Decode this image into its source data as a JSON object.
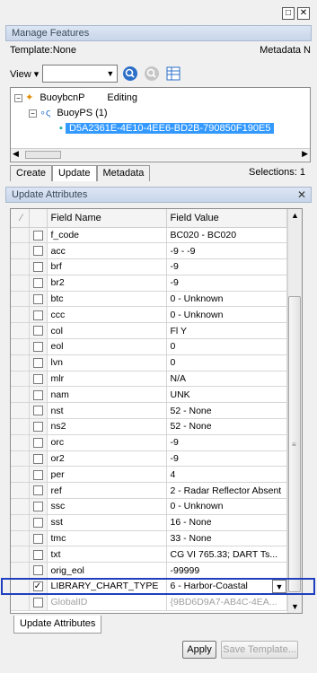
{
  "titlebar": {
    "restore_glyph": "□",
    "close_glyph": "✕"
  },
  "manage_features": {
    "title": "Manage Features",
    "template_label": "Template:None",
    "template_right": "Metadata N",
    "view_label": "View ▾",
    "tree": {
      "layer": "BuoybcnP",
      "layer_status": "Editing",
      "class": "BuoyPS (1)",
      "feature": "D5A2361E-4E10-4EE6-BD2B-790850F190E5"
    },
    "tabs": [
      "Create",
      "Update",
      "Metadata"
    ],
    "selections": "Selections: 1"
  },
  "update_attributes": {
    "title": "Update Attributes",
    "columns": {
      "check": "",
      "name": "Field Name",
      "value": "Field Value"
    },
    "rows": [
      {
        "name": "f_code",
        "value": "BC020 - BC020",
        "checked": false
      },
      {
        "name": "acc",
        "value": "-9 - -9",
        "checked": false
      },
      {
        "name": "brf",
        "value": "-9",
        "checked": false
      },
      {
        "name": "br2",
        "value": "-9",
        "checked": false
      },
      {
        "name": "btc",
        "value": "0 - Unknown",
        "checked": false
      },
      {
        "name": "ccc",
        "value": "0 - Unknown",
        "checked": false
      },
      {
        "name": "col",
        "value": "Fl Y",
        "checked": false
      },
      {
        "name": "eol",
        "value": "0",
        "checked": false
      },
      {
        "name": "lvn",
        "value": "0",
        "checked": false
      },
      {
        "name": "mlr",
        "value": "N/A",
        "checked": false
      },
      {
        "name": "nam",
        "value": "UNK",
        "checked": false
      },
      {
        "name": "nst",
        "value": "52 - None",
        "checked": false
      },
      {
        "name": "ns2",
        "value": "52 - None",
        "checked": false
      },
      {
        "name": "orc",
        "value": "-9",
        "checked": false
      },
      {
        "name": "or2",
        "value": "-9",
        "checked": false
      },
      {
        "name": "per",
        "value": "4",
        "checked": false
      },
      {
        "name": "ref",
        "value": "2 - Radar Reflector Absent",
        "checked": false
      },
      {
        "name": "ssc",
        "value": "0 - Unknown",
        "checked": false
      },
      {
        "name": "sst",
        "value": "16 - None",
        "checked": false
      },
      {
        "name": "tmc",
        "value": "33 - None",
        "checked": false
      },
      {
        "name": "txt",
        "value": "CG VI 765.33; DART Ts...",
        "checked": false
      },
      {
        "name": "orig_eol",
        "value": "-99999",
        "checked": false
      },
      {
        "name": "LIBRARY_CHART_TYPE",
        "value": "6 - Harbor-Coastal",
        "checked": true
      },
      {
        "name": "GlobalID",
        "value": "{9BD6D9A7-AB4C-4EA...",
        "checked": false
      }
    ],
    "bottom_tab": "Update Attributes",
    "apply_label": "Apply",
    "save_template_label": "Save Template..."
  }
}
